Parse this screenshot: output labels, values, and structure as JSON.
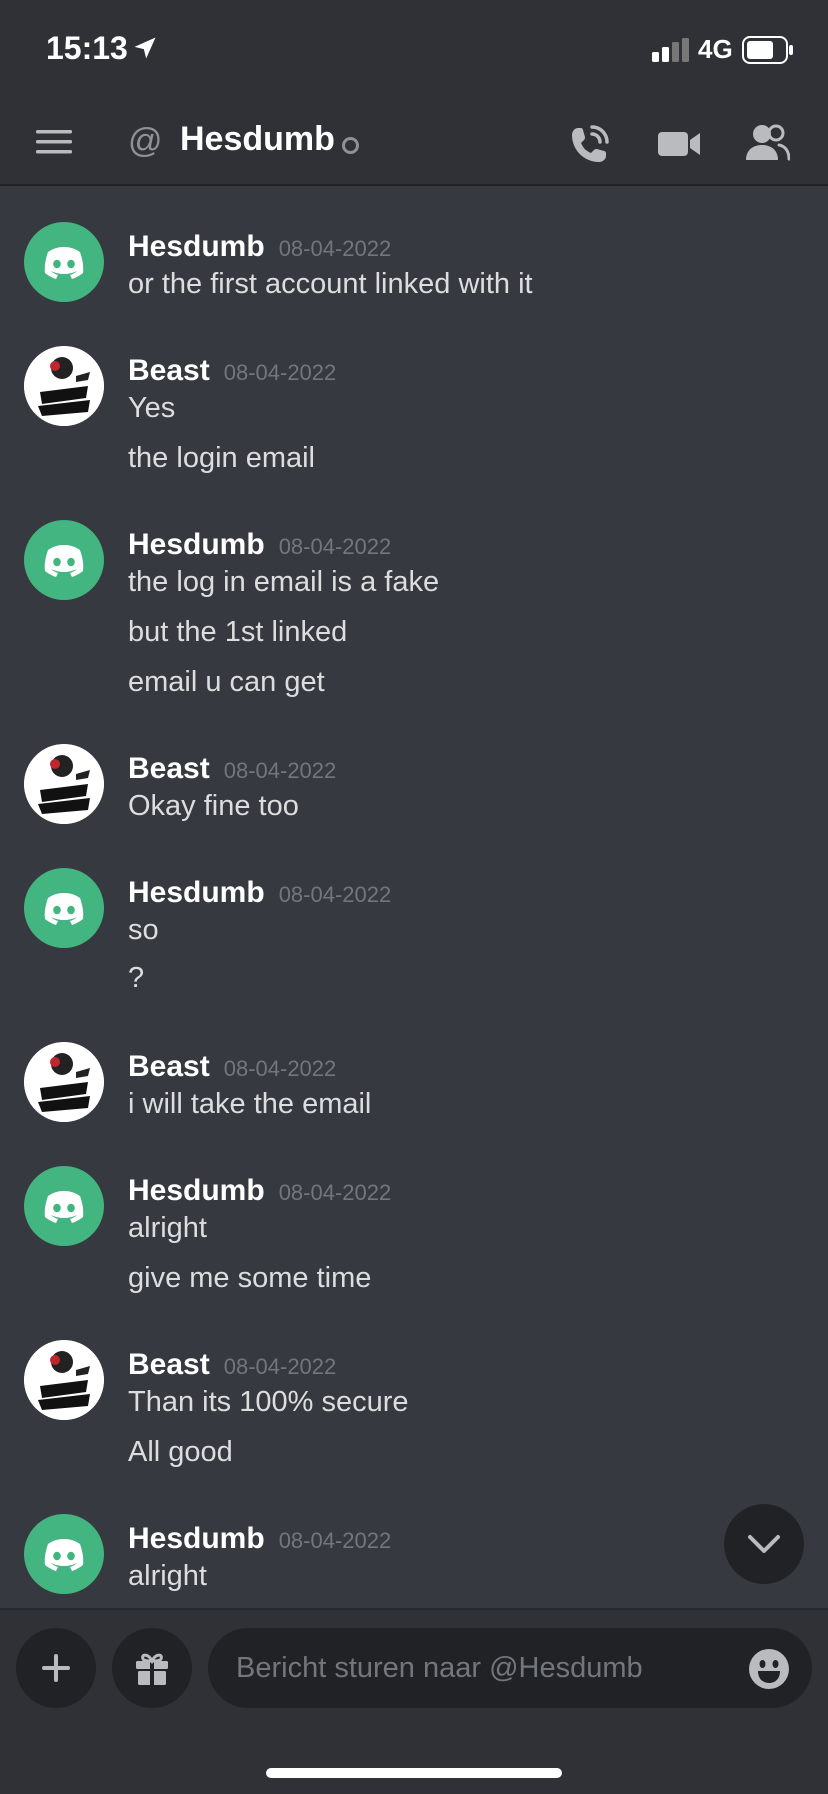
{
  "status_bar": {
    "time": "15:13",
    "network": "4G"
  },
  "header": {
    "at_symbol": "@",
    "title": "Hesdumb"
  },
  "messages": [
    {
      "author": "Hesdumb",
      "timestamp": "08-04-2022",
      "avatar": "discord",
      "lines": [
        "or the first account linked with it"
      ]
    },
    {
      "author": "Beast",
      "timestamp": "08-04-2022",
      "avatar": "beast",
      "lines": [
        "Yes",
        "the login email"
      ]
    },
    {
      "author": "Hesdumb",
      "timestamp": "08-04-2022",
      "avatar": "discord",
      "lines": [
        "the log in email is a fake",
        "but the 1st linked",
        "email u can get"
      ]
    },
    {
      "author": "Beast",
      "timestamp": "08-04-2022",
      "avatar": "beast",
      "lines": [
        "Okay fine too"
      ]
    },
    {
      "author": "Hesdumb",
      "timestamp": "08-04-2022",
      "avatar": "discord",
      "lines": [
        "so",
        "?"
      ]
    },
    {
      "author": "Beast",
      "timestamp": "08-04-2022",
      "avatar": "beast",
      "lines": [
        "i will take the email"
      ]
    },
    {
      "author": "Hesdumb",
      "timestamp": "08-04-2022",
      "avatar": "discord",
      "lines": [
        "alright",
        "give me some time"
      ]
    },
    {
      "author": "Beast",
      "timestamp": "08-04-2022",
      "avatar": "beast",
      "lines": [
        "Than its 100% secure",
        "All good"
      ]
    },
    {
      "author": "Hesdumb",
      "timestamp": "08-04-2022",
      "avatar": "discord",
      "lines": [
        "alright"
      ]
    }
  ],
  "composer": {
    "placeholder": "Bericht sturen naar @Hesdumb"
  },
  "colors": {
    "background": "#36393f",
    "header": "#2f3136",
    "discord_green": "#43b581"
  }
}
